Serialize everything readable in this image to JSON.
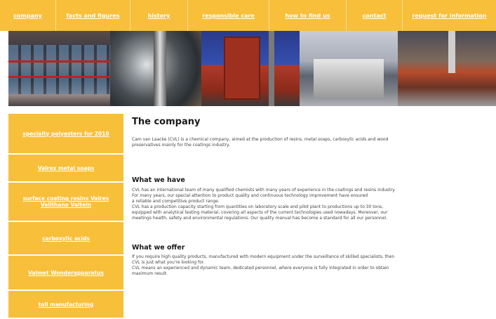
{
  "nav": {
    "items": [
      {
        "label": "company"
      },
      {
        "label": "facts and figures"
      },
      {
        "label": "history"
      },
      {
        "label": "responsible care"
      },
      {
        "label": "how to find us"
      },
      {
        "label": "contact"
      },
      {
        "label": "request for information"
      }
    ]
  },
  "sidebar": {
    "items": [
      {
        "label": "specialty polyesters for 2010"
      },
      {
        "label": "Valrex metal soaps"
      },
      {
        "label": "surface coating resins Valres Valithane Valtein"
      },
      {
        "label": "carboxylic acids"
      },
      {
        "label": "Valmet Wonderapparatus"
      },
      {
        "label": "toll manufacturing"
      }
    ]
  },
  "main": {
    "title": "The company",
    "intro": [
      "Cam van Laacke (CVL) is a chemical company, aimed at the production of resins, metal soaps, carboxylic acids and wood",
      "preservatives mainly for the coatings industry."
    ],
    "section1": {
      "heading": "What we have",
      "lines": [
        "CVL has an international team of many qualified chemists with many years of experience in the coatings and resins industry.",
        "For many years, our special attention to product quality and continuous technology improvement have ensured",
        "a reliable and competitive product range.",
        "CVL has a production capacity starting from quantities on laboratory scale and pilot plant to productions up to 30 tons,",
        "equipped with analytical testing material, covering all aspects of the current technologies used nowadays. Moreover, our",
        "meetings health, safety and environmental regulations. Our quality manual has become a standard for all our personnel."
      ]
    },
    "section2": {
      "heading": "What we offer",
      "lines": [
        "If you require high quality products, manufactured with modern equipment under the surveillance of skilled specialists, then",
        "CVL is just what you're looking for.",
        "CVL means an experienced and dynamic team, dedicated personnel, where everyone is fully integrated in order to obtain",
        "maximum result."
      ]
    }
  }
}
